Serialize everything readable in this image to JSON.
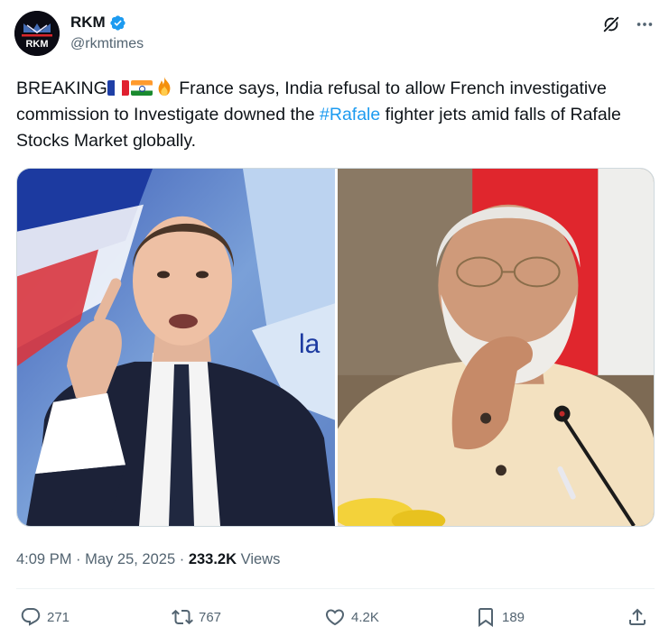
{
  "author": {
    "display_name": "RKM",
    "handle": "@rkmtimes",
    "avatar_text": "RKM",
    "verified": true
  },
  "tweet": {
    "text_lead": "BREAKING",
    "flags": [
      "france-flag",
      "india-flag",
      "fire-emoji"
    ],
    "text_main": " France says, India refusal to allow French investigative commission to Investigate downed the ",
    "hashtag": "#Rafale",
    "text_tail": " fighter jets amid falls of Rafale Stocks Market globally."
  },
  "media": {
    "left_photo_overlay_text": "la"
  },
  "meta": {
    "time": "4:09 PM",
    "separator": "·",
    "date": "May 25, 2025",
    "views_count": "233.2K",
    "views_label": "Views"
  },
  "actions": {
    "replies": "271",
    "reposts": "767",
    "likes": "4.2K",
    "bookmarks": "189"
  },
  "colors": {
    "accent": "#1d9bf0",
    "secondary_text": "#536471",
    "primary_text": "#0f1419"
  }
}
